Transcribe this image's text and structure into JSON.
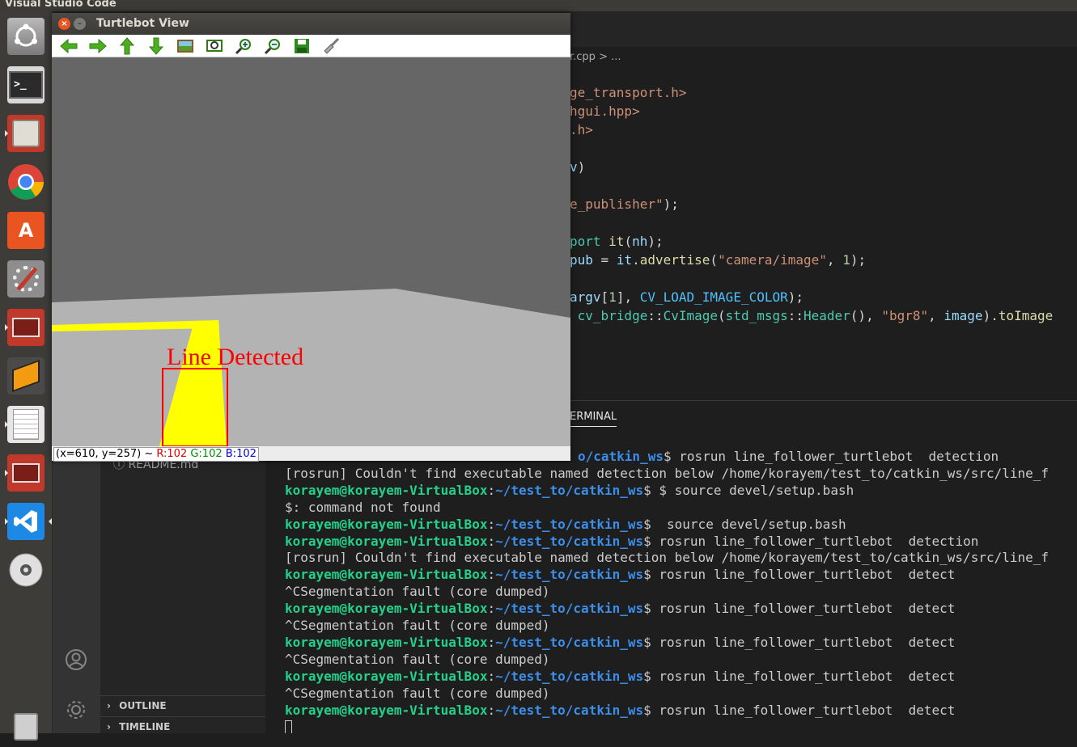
{
  "topbar": {
    "app_title": "Visual Studio Code"
  },
  "launcher": {
    "items": [
      {
        "name": "ubuntu-dash"
      },
      {
        "name": "terminal"
      },
      {
        "name": "files"
      },
      {
        "name": "chrome"
      },
      {
        "name": "software-center"
      },
      {
        "name": "system-settings"
      },
      {
        "name": "workspace-app"
      },
      {
        "name": "box-app"
      },
      {
        "name": "text-editor"
      },
      {
        "name": "workspace-app-2"
      },
      {
        "name": "vscode"
      },
      {
        "name": "dvd"
      },
      {
        "name": "trash"
      }
    ]
  },
  "turtlebot": {
    "title": "Turtlebot View",
    "toolbar": [
      "back-arrow-icon",
      "forward-arrow-icon",
      "up-arrow-icon",
      "down-arrow-icon",
      "image-icon",
      "zoom-fit-icon",
      "zoom-in-icon",
      "zoom-out-icon",
      "save-icon",
      "clear-icon"
    ],
    "overlay_text": "Line Detected",
    "status": {
      "coords": "(x=610, y=257) ~",
      "r": "R:102",
      "g": "G:102",
      "b": "B:102"
    }
  },
  "vscode": {
    "breadcrumb": "r.cpp  >  ...",
    "code_lines": [
      {
        "parts": [
          {
            "t": "ge_transport.h>",
            "c": "#ce9178"
          }
        ]
      },
      {
        "parts": [
          {
            "t": "hgui.hpp>",
            "c": "#ce9178"
          }
        ]
      },
      {
        "parts": [
          {
            "t": ".h>",
            "c": "#ce9178"
          }
        ]
      },
      {
        "parts": []
      },
      {
        "parts": [
          {
            "t": "v",
            "c": "#9cdcfe"
          },
          {
            "t": ")",
            "c": "#d4d4d4"
          }
        ]
      },
      {
        "parts": []
      },
      {
        "parts": [
          {
            "t": "e_publisher\"",
            "c": "#ce9178"
          },
          {
            "t": ");",
            "c": "#d4d4d4"
          }
        ]
      },
      {
        "parts": []
      },
      {
        "parts": [
          {
            "t": "port ",
            "c": "#4ec9b0"
          },
          {
            "t": "it",
            "c": "#dcdcaa"
          },
          {
            "t": "(",
            "c": "#d4d4d4"
          },
          {
            "t": "nh",
            "c": "#9cdcfe"
          },
          {
            "t": ");",
            "c": "#d4d4d4"
          }
        ]
      },
      {
        "parts": [
          {
            "t": "pub",
            "c": "#9cdcfe"
          },
          {
            "t": " = ",
            "c": "#d4d4d4"
          },
          {
            "t": "it",
            "c": "#9cdcfe"
          },
          {
            "t": ".",
            "c": "#d4d4d4"
          },
          {
            "t": "advertise",
            "c": "#dcdcaa"
          },
          {
            "t": "(",
            "c": "#d4d4d4"
          },
          {
            "t": "\"camera/image\"",
            "c": "#ce9178"
          },
          {
            "t": ", ",
            "c": "#d4d4d4"
          },
          {
            "t": "1",
            "c": "#b5cea8"
          },
          {
            "t": ");",
            "c": "#d4d4d4"
          }
        ]
      },
      {
        "parts": []
      },
      {
        "parts": [
          {
            "t": "argv",
            "c": "#9cdcfe"
          },
          {
            "t": "[",
            "c": "#d4d4d4"
          },
          {
            "t": "1",
            "c": "#b5cea8"
          },
          {
            "t": "], ",
            "c": "#d4d4d4"
          },
          {
            "t": "CV_LOAD_IMAGE_COLOR",
            "c": "#4fc1ff"
          },
          {
            "t": ");",
            "c": "#d4d4d4"
          }
        ]
      },
      {
        "parts": [
          {
            "t": " cv_bridge",
            "c": "#4ec9b0"
          },
          {
            "t": "::",
            "c": "#d4d4d4"
          },
          {
            "t": "CvImage",
            "c": "#4ec9b0"
          },
          {
            "t": "(",
            "c": "#d4d4d4"
          },
          {
            "t": "std_msgs",
            "c": "#4ec9b0"
          },
          {
            "t": "::",
            "c": "#d4d4d4"
          },
          {
            "t": "Header",
            "c": "#4ec9b0"
          },
          {
            "t": "(), ",
            "c": "#d4d4d4"
          },
          {
            "t": "\"bgr8\"",
            "c": "#ce9178"
          },
          {
            "t": ", ",
            "c": "#d4d4d4"
          },
          {
            "t": "image",
            "c": "#9cdcfe"
          },
          {
            "t": ").",
            "c": "#d4d4d4"
          },
          {
            "t": "toImage",
            "c": "#dcdcaa"
          }
        ]
      }
    ],
    "panel_tab": "ERMINAL",
    "sidebar": {
      "readme": "README.md",
      "outline": "OUTLINE",
      "timeline": "TIMELINE"
    }
  },
  "terminal": {
    "lines": [
      {
        "path": "o/catkin_ws",
        "cmd": "$ rosrun line_follower_turtlebot  detection",
        "offset": true
      },
      {
        "text": "[rosrun] Couldn't find executable named detection below /home/korayem/test_to/catkin_ws/src/line_f"
      },
      {
        "user": "korayem@korayem-VirtualBox",
        "path": "~/test_to/catkin_ws",
        "cmd": "$ $ source devel/setup.bash"
      },
      {
        "text": "$: command not found"
      },
      {
        "user": "korayem@korayem-VirtualBox",
        "path": "~/test_to/catkin_ws",
        "cmd": "$  source devel/setup.bash"
      },
      {
        "user": "korayem@korayem-VirtualBox",
        "path": "~/test_to/catkin_ws",
        "cmd": "$ rosrun line_follower_turtlebot  detection"
      },
      {
        "text": "[rosrun] Couldn't find executable named detection below /home/korayem/test_to/catkin_ws/src/line_f"
      },
      {
        "user": "korayem@korayem-VirtualBox",
        "path": "~/test_to/catkin_ws",
        "cmd": "$ rosrun line_follower_turtlebot  detect"
      },
      {
        "text": "^CSegmentation fault (core dumped)"
      },
      {
        "user": "korayem@korayem-VirtualBox",
        "path": "~/test_to/catkin_ws",
        "cmd": "$ rosrun line_follower_turtlebot  detect"
      },
      {
        "text": "^CSegmentation fault (core dumped)"
      },
      {
        "user": "korayem@korayem-VirtualBox",
        "path": "~/test_to/catkin_ws",
        "cmd": "$ rosrun line_follower_turtlebot  detect"
      },
      {
        "text": "^CSegmentation fault (core dumped)"
      },
      {
        "user": "korayem@korayem-VirtualBox",
        "path": "~/test_to/catkin_ws",
        "cmd": "$ rosrun line_follower_turtlebot  detect"
      },
      {
        "text": "^CSegmentation fault (core dumped)"
      },
      {
        "user": "korayem@korayem-VirtualBox",
        "path": "~/test_to/catkin_ws",
        "cmd": "$ rosrun line_follower_turtlebot  detect"
      }
    ]
  }
}
